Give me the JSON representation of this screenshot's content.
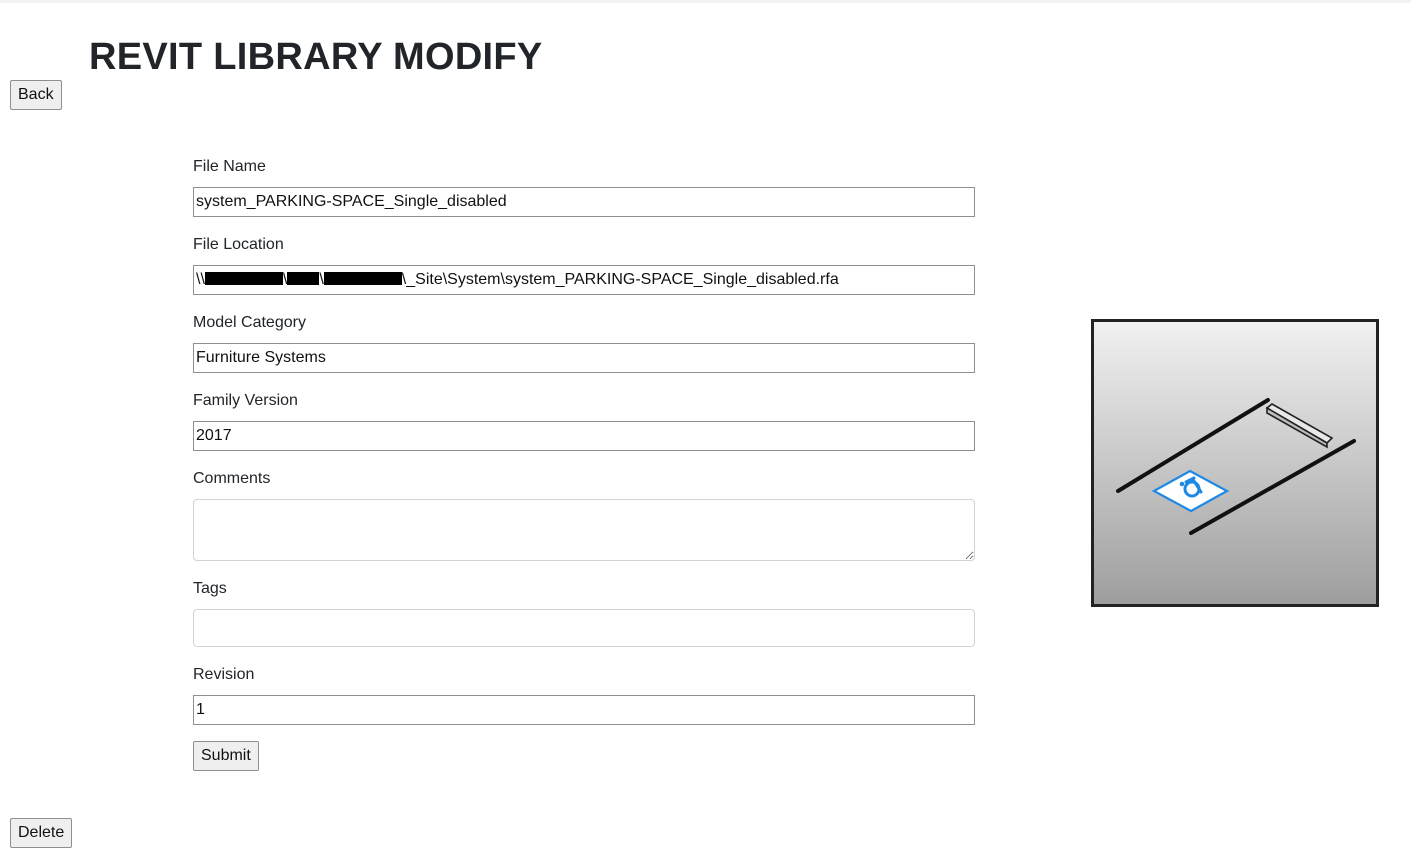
{
  "page": {
    "title": "REVIT LIBRARY MODIFY"
  },
  "buttons": {
    "back": "Back",
    "submit": "Submit",
    "delete": "Delete"
  },
  "form": {
    "file_name": {
      "label": "File Name",
      "value": "system_PARKING-SPACE_Single_disabled"
    },
    "file_location": {
      "label": "File Location",
      "value_prefix": "\\\\",
      "value_suffix": "\\_Site\\System\\system_PARKING-SPACE_Single_disabled.rfa"
    },
    "model_category": {
      "label": "Model Category",
      "value": "Furniture Systems"
    },
    "family_version": {
      "label": "Family Version",
      "value": "2017"
    },
    "comments": {
      "label": "Comments",
      "value": ""
    },
    "tags": {
      "label": "Tags",
      "value": ""
    },
    "revision": {
      "label": "Revision",
      "value": "1"
    }
  },
  "preview": {
    "icon": "parking-space-disabled-thumbnail",
    "accessible_symbol_color": "#1e88e5"
  }
}
